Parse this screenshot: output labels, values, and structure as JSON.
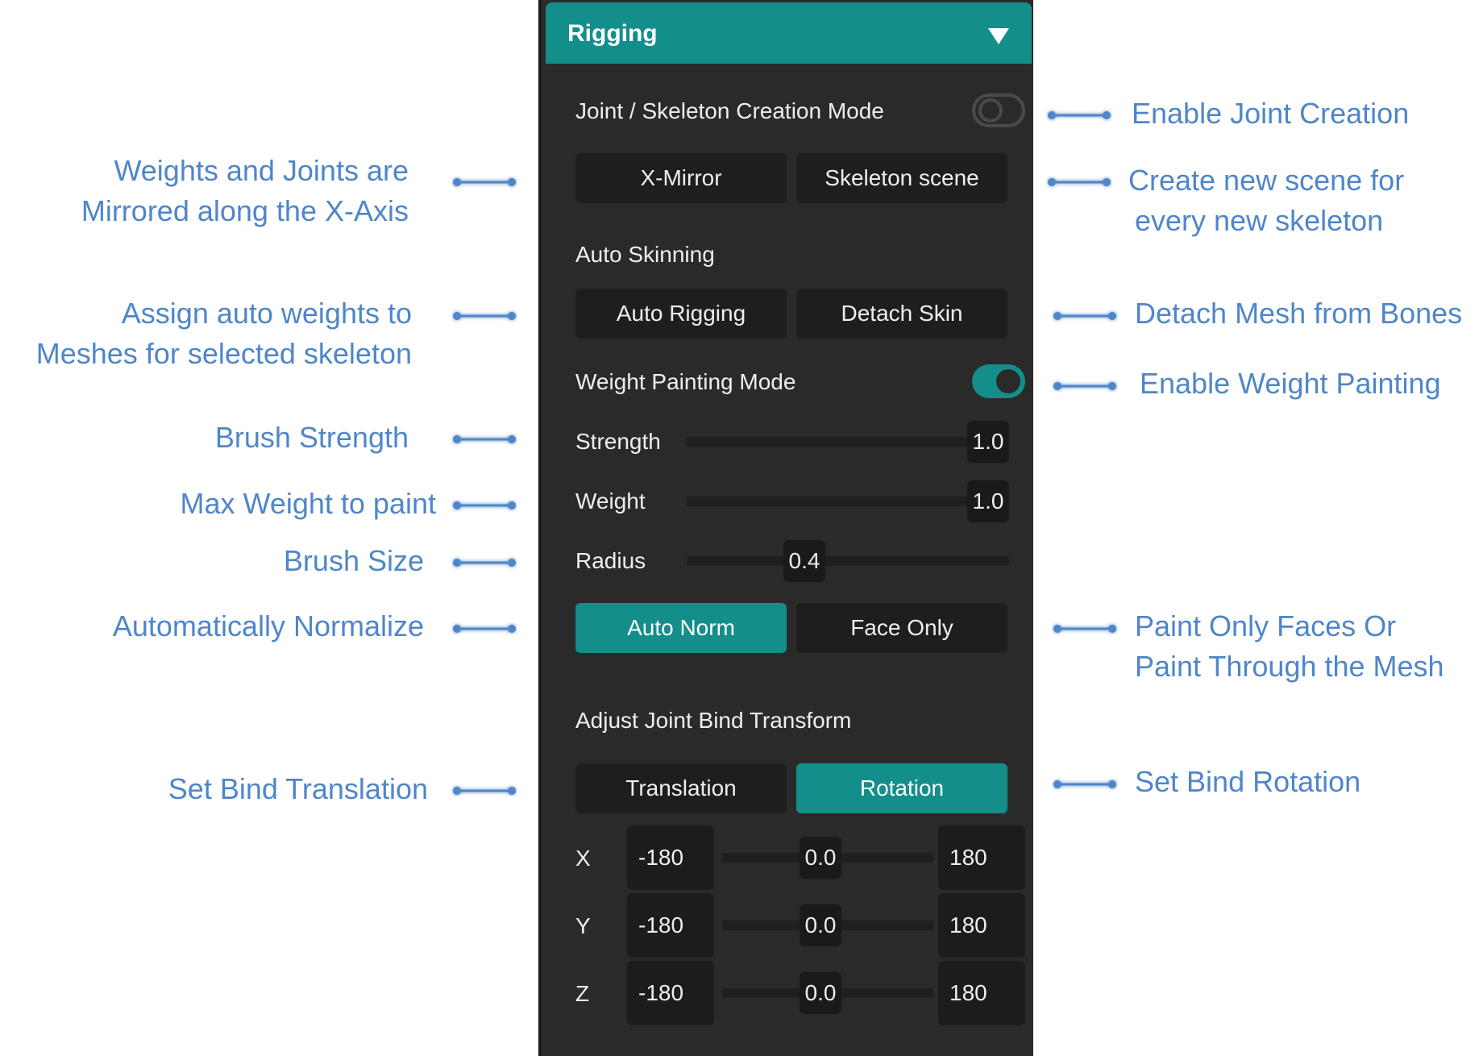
{
  "panel": {
    "title": "Rigging",
    "joint_mode_label": "Joint / Skeleton Creation Mode",
    "x_mirror": "X-Mirror",
    "skeleton_scene": "Skeleton scene",
    "auto_skinning_label": "Auto Skinning",
    "auto_rigging": "Auto Rigging",
    "detach_skin": "Detach Skin",
    "weight_painting_label": "Weight Painting Mode",
    "strength": {
      "label": "Strength",
      "value": "1.0"
    },
    "weight": {
      "label": "Weight",
      "value": "1.0"
    },
    "radius": {
      "label": "Radius",
      "value": "0.4"
    },
    "auto_norm": "Auto Norm",
    "face_only": "Face Only",
    "bind_label": "Adjust Joint Bind Transform",
    "translation": "Translation",
    "rotation": "Rotation",
    "axes": [
      {
        "axis": "X",
        "min": "-180",
        "value": "0.0",
        "max": "180"
      },
      {
        "axis": "Y",
        "min": "-180",
        "value": "0.0",
        "max": "180"
      },
      {
        "axis": "Z",
        "min": "-180",
        "value": "0.0",
        "max": "180"
      }
    ],
    "joint_mode_enabled": false,
    "weight_painting_enabled": true,
    "accent_color": "#138e8b"
  },
  "annotations": {
    "enable_joint": "Enable Joint Creation",
    "mirror_1": "Weights and Joints are",
    "mirror_2": "Mirrored along the X-Axis",
    "new_scene_1": "Create new scene for",
    "new_scene_2": "every new skeleton",
    "auto_weights_1": "Assign auto weights to",
    "auto_weights_2": "Meshes for selected skeleton",
    "detach": "Detach Mesh from Bones",
    "enable_weight": "Enable Weight Painting",
    "brush_strength": "Brush Strength",
    "max_weight": "Max Weight to paint",
    "brush_size": "Brush Size",
    "auto_normalize": "Automatically Normalize",
    "paint_faces_1": "Paint Only Faces Or",
    "paint_faces_2": "Paint Through the Mesh",
    "bind_translation": "Set Bind Translation",
    "bind_rotation": "Set Bind Rotation",
    "text_color": "#4f86c9"
  }
}
